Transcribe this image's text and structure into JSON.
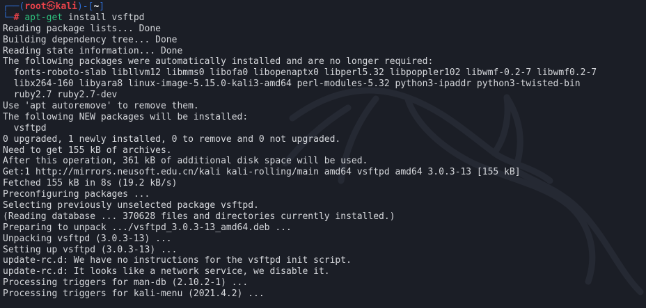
{
  "prompt": {
    "box_top_left": "┌──(",
    "user": "root",
    "skull": "㉿",
    "host": "kali",
    "mid": ")-[",
    "cwd": "~",
    "close": "]",
    "box_bottom_left": "└─",
    "hash": "#",
    "command_name": "apt-get",
    "command_args": " install vsftpd"
  },
  "output_lines": [
    "Reading package lists... Done",
    "Building dependency tree... Done",
    "Reading state information... Done",
    "The following packages were automatically installed and are no longer required:",
    "  fonts-roboto-slab libllvm12 libmms0 libofa0 libopenaptx0 libperl5.32 libpoppler102 libwmf-0.2-7 libwmf0.2-7",
    "  libx264-160 libyara8 linux-image-5.15.0-kali3-amd64 perl-modules-5.32 python3-ipaddr python3-twisted-bin",
    "  ruby2.7 ruby2.7-dev",
    "Use 'apt autoremove' to remove them.",
    "The following NEW packages will be installed:",
    "  vsftpd",
    "0 upgraded, 1 newly installed, 0 to remove and 0 not upgraded.",
    "Need to get 155 kB of archives.",
    "After this operation, 361 kB of additional disk space will be used.",
    "Get:1 http://mirrors.neusoft.edu.cn/kali kali-rolling/main amd64 vsftpd amd64 3.0.3-13 [155 kB]",
    "Fetched 155 kB in 8s (19.2 kB/s)",
    "Preconfiguring packages ...",
    "Selecting previously unselected package vsftpd.",
    "(Reading database ... 370628 files and directories currently installed.)",
    "Preparing to unpack .../vsftpd_3.0.3-13_amd64.deb ...",
    "Unpacking vsftpd (3.0.3-13) ...",
    "Setting up vsftpd (3.0.3-13) ...",
    "update-rc.d: We have no instructions for the vsftpd init script.",
    "update-rc.d: It looks like a network service, we disable it.",
    "Processing triggers for man-db (2.10.2-1) ...",
    "Processing triggers for kali-menu (2021.4.2) ..."
  ],
  "colors": {
    "background": "#1b1e26",
    "prompt_box": "#2f6fd6",
    "prompt_user_host": "#e8424a",
    "command": "#2ec27e",
    "text": "#d6d8dc"
  },
  "icons": {
    "background_logo": "kali-dragon-logo-icon"
  }
}
